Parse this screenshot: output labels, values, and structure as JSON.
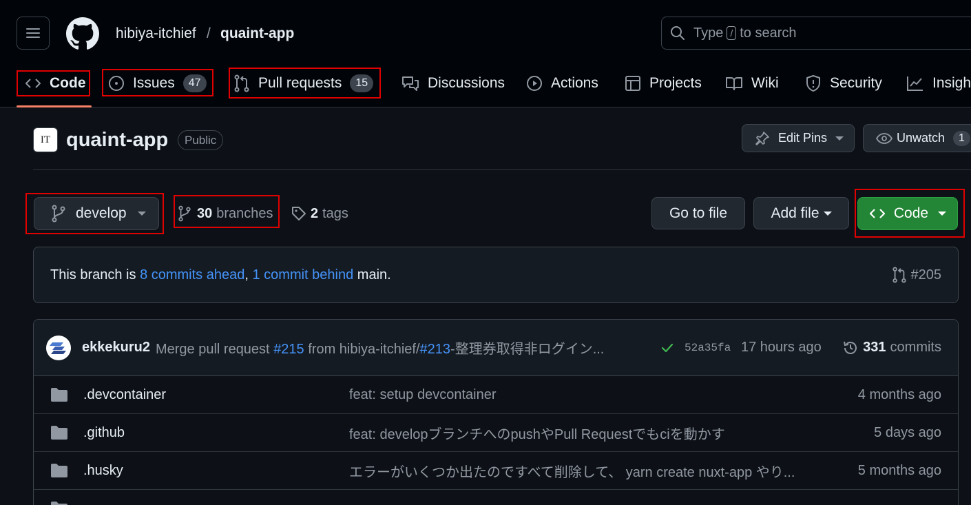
{
  "header": {
    "owner": "hibiya-itchief",
    "separator": "/",
    "repo": "quaint-app",
    "search_prefix": "Type",
    "search_key": "/",
    "search_suffix": "to search"
  },
  "tabs": [
    {
      "label": "Code",
      "icon": "code-icon",
      "selected": true
    },
    {
      "label": "Issues",
      "count": "47",
      "icon": "issue-opened-icon"
    },
    {
      "label": "Pull requests",
      "count": "15",
      "icon": "git-pull-request-icon"
    },
    {
      "label": "Discussions",
      "icon": "comment-discussion-icon"
    },
    {
      "label": "Actions",
      "icon": "play-icon"
    },
    {
      "label": "Projects",
      "icon": "table-icon"
    },
    {
      "label": "Wiki",
      "icon": "book-icon"
    },
    {
      "label": "Security",
      "icon": "shield-icon"
    },
    {
      "label": "Insigh",
      "icon": "graph-icon"
    }
  ],
  "repo_header": {
    "avatar_text": "IT",
    "name": "quaint-app",
    "visibility": "Public",
    "edit_pins": "Edit Pins",
    "unwatch": "Unwatch",
    "watch_count": "1"
  },
  "branch_bar": {
    "branch": "develop",
    "branches_count": "30",
    "branches_label": "branches",
    "tags_count": "2",
    "tags_label": "tags",
    "go_to_file": "Go to file",
    "add_file": "Add file",
    "code_button": "Code"
  },
  "banner": {
    "prefix": "This branch is",
    "ahead": "8 commits ahead",
    "comma": ",",
    "behind": "1 commit behind",
    "suffix": "main.",
    "pr_ref": "#205"
  },
  "latest_commit": {
    "author": "ekkekuru2",
    "msg_prefix": "Merge pull request",
    "pr_link": "#215",
    "msg_middle": "from hibiya-itchief/",
    "issue_link": "#213",
    "msg_rest": "-整理券取得非ログイン...",
    "sha": "52a35fa",
    "time": "17 hours ago",
    "commit_count": "331",
    "commit_label": "commits"
  },
  "files": [
    {
      "name": ".devcontainer",
      "message": "feat: setup devcontainer",
      "age": "4 months ago"
    },
    {
      "name": ".github",
      "message": "feat: developブランチへのpushやPull Requestでもciを動かす",
      "age": "5 days ago"
    },
    {
      "name": ".husky",
      "message": "エラーがいくつか出たのですべて削除して、 yarn create nuxt-app やり...",
      "age": "5 months ago"
    },
    {
      "name": "",
      "message": "",
      "age": ""
    }
  ],
  "colors": {
    "background": "#0d1117",
    "header": "#010409",
    "accent_underline": "#f78166",
    "link": "#4493f8",
    "primary_button": "#238636",
    "success": "#3fb950",
    "annotation_box": "#e00000"
  }
}
